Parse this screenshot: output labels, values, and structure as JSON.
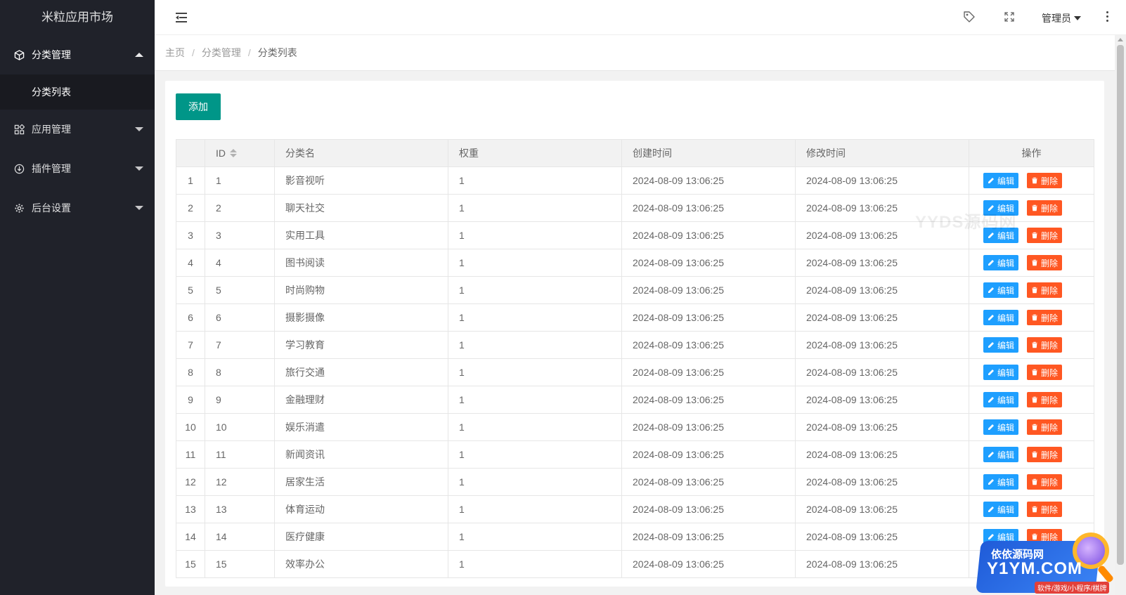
{
  "app": {
    "title": "米粒应用市场"
  },
  "sidebar": {
    "items": [
      {
        "label": "分类管理",
        "icon": "cube-icon",
        "expanded": true,
        "children": [
          {
            "label": "分类列表"
          }
        ]
      },
      {
        "label": "应用管理",
        "icon": "apps-icon",
        "expanded": false
      },
      {
        "label": "插件管理",
        "icon": "plugin-icon",
        "expanded": false
      },
      {
        "label": "后台设置",
        "icon": "gear-icon",
        "expanded": false
      }
    ]
  },
  "header": {
    "menu_toggle_icon": "menu-toggle-icon",
    "tag_icon": "tag-icon",
    "fullscreen_icon": "fullscreen-icon",
    "user_label": "管理员",
    "more_icon": "more-vertical-icon"
  },
  "breadcrumb": {
    "home": "主页",
    "section": "分类管理",
    "current": "分类列表"
  },
  "toolbar": {
    "add_label": "添加"
  },
  "table": {
    "columns": [
      "",
      "ID",
      "分类名",
      "权重",
      "创建时间",
      "修改时间",
      "操作"
    ],
    "edit_label": "编辑",
    "delete_label": "删除",
    "rows": [
      {
        "idx": "1",
        "id": "1",
        "name": "影音视听",
        "weight": "1",
        "created": "2024-08-09 13:06:25",
        "modified": "2024-08-09 13:06:25"
      },
      {
        "idx": "2",
        "id": "2",
        "name": "聊天社交",
        "weight": "1",
        "created": "2024-08-09 13:06:25",
        "modified": "2024-08-09 13:06:25"
      },
      {
        "idx": "3",
        "id": "3",
        "name": "实用工具",
        "weight": "1",
        "created": "2024-08-09 13:06:25",
        "modified": "2024-08-09 13:06:25"
      },
      {
        "idx": "4",
        "id": "4",
        "name": "图书阅读",
        "weight": "1",
        "created": "2024-08-09 13:06:25",
        "modified": "2024-08-09 13:06:25"
      },
      {
        "idx": "5",
        "id": "5",
        "name": "时尚购物",
        "weight": "1",
        "created": "2024-08-09 13:06:25",
        "modified": "2024-08-09 13:06:25"
      },
      {
        "idx": "6",
        "id": "6",
        "name": "摄影摄像",
        "weight": "1",
        "created": "2024-08-09 13:06:25",
        "modified": "2024-08-09 13:06:25"
      },
      {
        "idx": "7",
        "id": "7",
        "name": "学习教育",
        "weight": "1",
        "created": "2024-08-09 13:06:25",
        "modified": "2024-08-09 13:06:25"
      },
      {
        "idx": "8",
        "id": "8",
        "name": "旅行交通",
        "weight": "1",
        "created": "2024-08-09 13:06:25",
        "modified": "2024-08-09 13:06:25"
      },
      {
        "idx": "9",
        "id": "9",
        "name": "金融理财",
        "weight": "1",
        "created": "2024-08-09 13:06:25",
        "modified": "2024-08-09 13:06:25"
      },
      {
        "idx": "10",
        "id": "10",
        "name": "娱乐消遣",
        "weight": "1",
        "created": "2024-08-09 13:06:25",
        "modified": "2024-08-09 13:06:25"
      },
      {
        "idx": "11",
        "id": "11",
        "name": "新闻资讯",
        "weight": "1",
        "created": "2024-08-09 13:06:25",
        "modified": "2024-08-09 13:06:25"
      },
      {
        "idx": "12",
        "id": "12",
        "name": "居家生活",
        "weight": "1",
        "created": "2024-08-09 13:06:25",
        "modified": "2024-08-09 13:06:25"
      },
      {
        "idx": "13",
        "id": "13",
        "name": "体育运动",
        "weight": "1",
        "created": "2024-08-09 13:06:25",
        "modified": "2024-08-09 13:06:25"
      },
      {
        "idx": "14",
        "id": "14",
        "name": "医疗健康",
        "weight": "1",
        "created": "2024-08-09 13:06:25",
        "modified": "2024-08-09 13:06:25"
      },
      {
        "idx": "15",
        "id": "15",
        "name": "效率办公",
        "weight": "1",
        "created": "2024-08-09 13:06:25",
        "modified": "2024-08-09 13:06:25"
      }
    ]
  },
  "watermark": {
    "text": "YYDS源码网"
  },
  "promo": {
    "line1": "依依源码网",
    "line2": "Y1YM.COM",
    "line3": "软件/游戏/小程序/棋牌"
  },
  "colors": {
    "sidebar_bg": "#20222a",
    "primary": "#009688",
    "edit": "#1e9fff",
    "delete": "#ff5722"
  }
}
